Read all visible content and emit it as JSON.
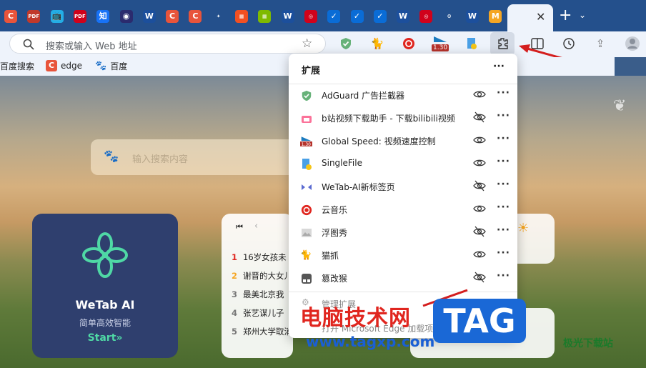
{
  "browser": {
    "tabs": [
      {
        "icon": "C",
        "color": "#e8543b"
      },
      {
        "icon": "PDF",
        "color": "#c0392b"
      },
      {
        "icon": "bili",
        "color": "#23ade5"
      },
      {
        "icon": "PDF",
        "color": "#d0021b"
      },
      {
        "icon": "知",
        "color": "#1772f6"
      },
      {
        "icon": "◉",
        "color": "#2b2b6e"
      },
      {
        "icon": "W",
        "color": "#1c4f9c"
      },
      {
        "icon": "C",
        "color": "#e8543b"
      },
      {
        "icon": "C",
        "color": "#e8543b"
      },
      {
        "icon": "puzzle",
        "color": "#24508c"
      },
      {
        "icon": "ms",
        "color": "#f25022"
      },
      {
        "icon": "ms",
        "color": "#7fba00"
      },
      {
        "icon": "W",
        "color": "#1c4f9c"
      },
      {
        "icon": "eye",
        "color": "#d0021b"
      },
      {
        "icon": "S",
        "color": "#0a6cd6"
      },
      {
        "icon": "S",
        "color": "#0a6cd6"
      },
      {
        "icon": "S",
        "color": "#0a6cd6"
      },
      {
        "icon": "W",
        "color": "#1c4f9c"
      },
      {
        "icon": "eye",
        "color": "#d0021b"
      },
      {
        "icon": "gear",
        "color": "#24508c"
      },
      {
        "icon": "W",
        "color": "#1c4f9c"
      },
      {
        "icon": "M",
        "color": "#f5a623"
      }
    ],
    "address_placeholder": "搜索或输入 Web 地址",
    "toolbar_badge": "1.30"
  },
  "favorites": [
    {
      "label": "百度搜索"
    },
    {
      "label": "edge"
    },
    {
      "label": "百度"
    }
  ],
  "ntp": {
    "search_placeholder": "输入搜索内容",
    "wetab_title": "WeTab AI",
    "wetab_subtitle": "简单高效智能",
    "wetab_start": "Start»",
    "news": [
      {
        "rank": "1",
        "text": "16岁女孩未"
      },
      {
        "rank": "2",
        "text": "谢晋的大女儿"
      },
      {
        "rank": "3",
        "text": "最美北京我"
      },
      {
        "rank": "4",
        "text": "张艺谋儿子"
      },
      {
        "rank": "5",
        "text": "郑州大学取消"
      }
    ]
  },
  "extensions": {
    "title": "扩展",
    "more": "···",
    "items": [
      {
        "name": "AdGuard 广告拦截器",
        "visible": true
      },
      {
        "name": "b站视频下载助手 - 下载bilibili视频",
        "visible": false
      },
      {
        "name": "Global Speed: 视频速度控制",
        "visible": true
      },
      {
        "name": "SingleFile",
        "visible": true
      },
      {
        "name": "WeTab-AI新标签页",
        "visible": false
      },
      {
        "name": "云音乐",
        "visible": true
      },
      {
        "name": "浮图秀",
        "visible": false
      },
      {
        "name": "猫抓",
        "visible": true
      },
      {
        "name": "篡改猴",
        "visible": false
      }
    ],
    "manage": "管理扩展",
    "open_addons": "打开 Microsoft Edge 加载项"
  },
  "watermark": {
    "cn": "电脑技术网",
    "url": "www.tagxp.com",
    "tag": "TAG",
    "site2": "极光下载站"
  }
}
